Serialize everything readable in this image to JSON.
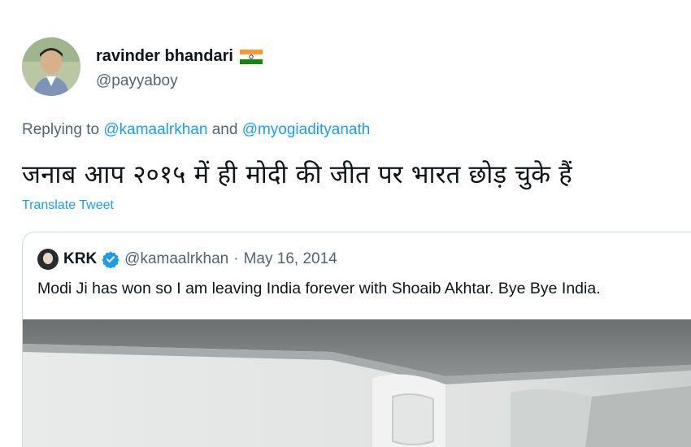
{
  "user": {
    "name": "ravinder bhandari",
    "handle": "@payyaboy"
  },
  "reply": {
    "prefix": "Replying to ",
    "mention_1": "@kamaalrkhan",
    "joiner": " and ",
    "mention_2": "@myogiadityanath"
  },
  "tweet": {
    "text": "जनाब आप २०१५ में ही मोदी की जीत पर भारत छोड़ चुके हैं",
    "translate_label": "Translate Tweet"
  },
  "quote": {
    "name": "KRK",
    "handle": "@kamaalrkhan",
    "separator": "·",
    "date": "May 16, 2014",
    "text": "Modi Ji has won so I am leaving India forever with Shoaib Akhtar. Bye Bye India.",
    "media_alt_icon": "airplane-cabin-photo"
  },
  "colors": {
    "link": "#1d9bf0",
    "secondary_text": "#536471",
    "primary_text": "#0f1419",
    "border": "#cfd9de"
  },
  "icons": {
    "flag": "india-flag-icon",
    "verified": "verified-badge-icon"
  }
}
